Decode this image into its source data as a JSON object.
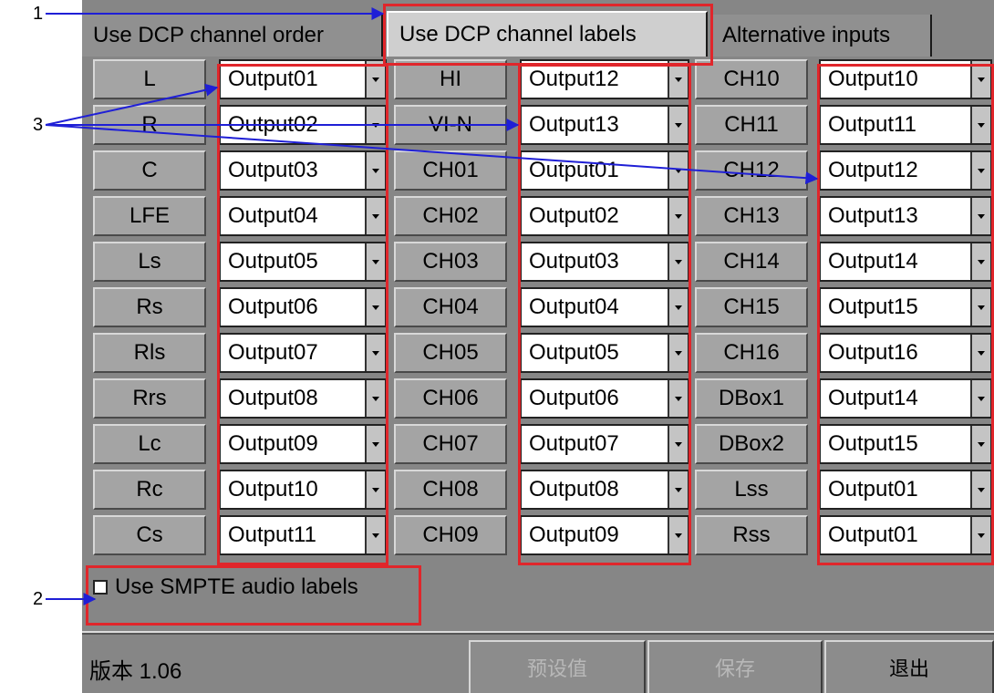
{
  "tabs": [
    {
      "label": "Use DCP channel order",
      "active": false
    },
    {
      "label": "Use DCP channel labels",
      "active": true
    },
    {
      "label": "Alternative inputs",
      "active": false
    }
  ],
  "columns": [
    {
      "rows": [
        {
          "label": "L",
          "value": "Output01"
        },
        {
          "label": "R",
          "value": "Output02"
        },
        {
          "label": "C",
          "value": "Output03"
        },
        {
          "label": "LFE",
          "value": "Output04"
        },
        {
          "label": "Ls",
          "value": "Output05"
        },
        {
          "label": "Rs",
          "value": "Output06"
        },
        {
          "label": "Rls",
          "value": "Output07"
        },
        {
          "label": "Rrs",
          "value": "Output08"
        },
        {
          "label": "Lc",
          "value": "Output09"
        },
        {
          "label": "Rc",
          "value": "Output10"
        },
        {
          "label": "Cs",
          "value": "Output11"
        }
      ]
    },
    {
      "rows": [
        {
          "label": "HI",
          "value": "Output12"
        },
        {
          "label": "VI-N",
          "value": "Output13"
        },
        {
          "label": "CH01",
          "value": "Output01"
        },
        {
          "label": "CH02",
          "value": "Output02"
        },
        {
          "label": "CH03",
          "value": "Output03"
        },
        {
          "label": "CH04",
          "value": "Output04"
        },
        {
          "label": "CH05",
          "value": "Output05"
        },
        {
          "label": "CH06",
          "value": "Output06"
        },
        {
          "label": "CH07",
          "value": "Output07"
        },
        {
          "label": "CH08",
          "value": "Output08"
        },
        {
          "label": "CH09",
          "value": "Output09"
        }
      ]
    },
    {
      "rows": [
        {
          "label": "CH10",
          "value": "Output10"
        },
        {
          "label": "CH11",
          "value": "Output11"
        },
        {
          "label": "CH12",
          "value": "Output12"
        },
        {
          "label": "CH13",
          "value": "Output13"
        },
        {
          "label": "CH14",
          "value": "Output14"
        },
        {
          "label": "CH15",
          "value": "Output15"
        },
        {
          "label": "CH16",
          "value": "Output16"
        },
        {
          "label": "DBox1",
          "value": "Output14"
        },
        {
          "label": "DBox2",
          "value": "Output15"
        },
        {
          "label": "Lss",
          "value": "Output01"
        },
        {
          "label": "Rss",
          "value": "Output01"
        }
      ]
    }
  ],
  "smpte": {
    "label": "Use SMPTE audio labels",
    "checked": false
  },
  "footer": {
    "version": "版本 1.06",
    "buttons": [
      {
        "label": "预设值",
        "enabled": false
      },
      {
        "label": "保存",
        "enabled": false
      },
      {
        "label": "退出",
        "enabled": true
      }
    ]
  },
  "callouts": [
    "1",
    "2",
    "3"
  ],
  "colors": {
    "panel": "#868686",
    "highlight": "#e0262b",
    "arrow": "#1f1fd6"
  }
}
